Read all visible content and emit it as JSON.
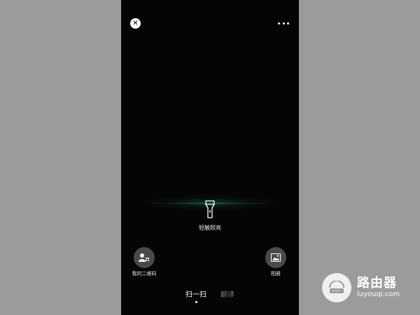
{
  "top_bar": {
    "close_icon": "close-icon",
    "more_icon": "more-horizontal-icon"
  },
  "torch": {
    "icon": "flashlight-icon",
    "label": "轻触照亮"
  },
  "left_action": {
    "icon": "my-qr-code-icon",
    "label": "我的二维码"
  },
  "right_action": {
    "icon": "album-icon",
    "label": "相册"
  },
  "tabs": [
    {
      "label": "扫一扫",
      "active": true
    },
    {
      "label": "翻译",
      "active": false
    }
  ],
  "watermark": {
    "title": "路由器",
    "subtitle": "luyouqi.com"
  },
  "colors": {
    "background": "#9b9b9b",
    "screen": "#050505",
    "scan_glow": "#46aa78"
  }
}
